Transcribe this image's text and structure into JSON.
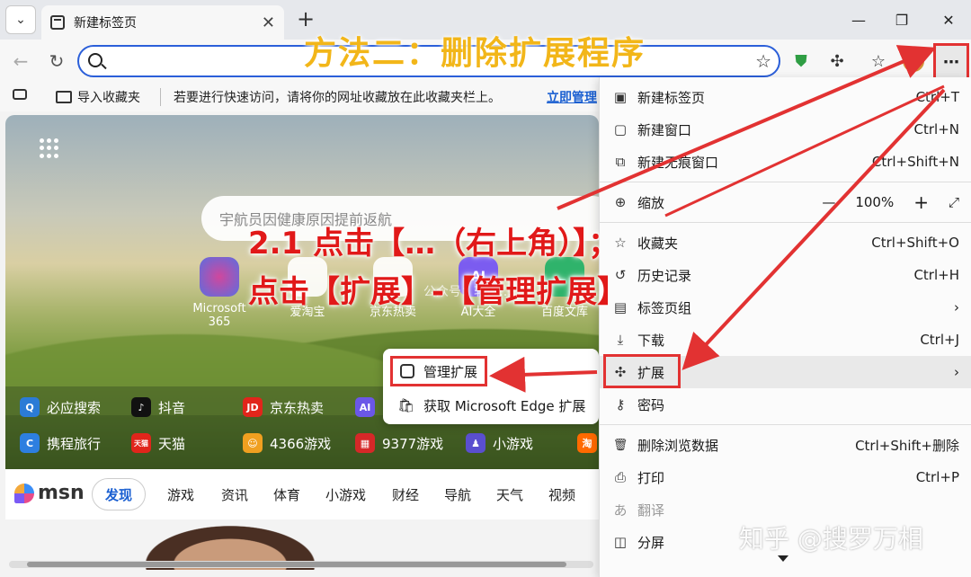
{
  "tab": {
    "title": "新建标签页"
  },
  "overlay_title": "方法二：删除扩展程序",
  "favorites": {
    "import_label": "导入收藏夹",
    "hint": "若要进行快速访问，请将你的网址收藏放在此收藏夹栏上。",
    "manage_link": "立即管理"
  },
  "page": {
    "search_placeholder": "宇航员因健康原因提前返航",
    "tiles": [
      {
        "label": "Microsoft 365",
        "icon": "microsoft-365-icon"
      },
      {
        "label": "爱淘宝",
        "icon": "taobao-icon"
      },
      {
        "label": "京东热卖",
        "icon": "jd-icon"
      },
      {
        "label": "AI大全",
        "icon": "ai-icon",
        "glyph": "AI"
      },
      {
        "label": "百度文库",
        "icon": "baidu-wenku-icon"
      }
    ],
    "watermark": "公众号：软件…",
    "quick_links_row1": [
      {
        "label": "必应搜索",
        "glyph": "Q",
        "color": "#2b7bd6"
      },
      {
        "label": "抖音",
        "glyph": "♪",
        "color": "#111111"
      },
      {
        "label": "京东热卖",
        "glyph": "JD",
        "color": "#e1251b"
      },
      {
        "label": "",
        "glyph": "AI",
        "color": "#6b57e8"
      }
    ],
    "quick_links_row2": [
      {
        "label": "携程旅行",
        "glyph": "C",
        "color": "#2d7fe0"
      },
      {
        "label": "天猫",
        "glyph": "天猫",
        "color": "#e1251b"
      },
      {
        "label": "4366游戏",
        "glyph": "☺",
        "color": "#f0a020"
      },
      {
        "label": "9377游戏",
        "glyph": "▦",
        "color": "#d62828"
      },
      {
        "label": "小游戏",
        "glyph": "♟",
        "color": "#5a4fcf"
      },
      {
        "label": "",
        "glyph": "淘",
        "color": "#ff6a00"
      }
    ],
    "ext_popup": {
      "manage": "管理扩展",
      "get": "获取 Microsoft Edge 扩展"
    }
  },
  "msn": {
    "brand": "msn",
    "discover": "发现",
    "nav": [
      "游戏",
      "资讯",
      "体育",
      "小游戏",
      "财经",
      "导航",
      "天气",
      "视频"
    ]
  },
  "menu": {
    "items": [
      {
        "label": "新建标签页",
        "shortcut": "Ctrl+T",
        "icon": "new-tab-icon",
        "glyph": "▣"
      },
      {
        "label": "新建窗口",
        "shortcut": "Ctrl+N",
        "icon": "new-window-icon",
        "glyph": "▢"
      },
      {
        "label": "新建无痕窗口",
        "shortcut": "Ctrl+Shift+N",
        "icon": "inprivate-icon",
        "glyph": "⧉"
      },
      {
        "label": "缩放",
        "shortcut": "",
        "icon": "zoom-icon",
        "glyph": "⊕"
      },
      {
        "label": "收藏夹",
        "shortcut": "Ctrl+Shift+O",
        "icon": "favorites-icon",
        "glyph": "☆"
      },
      {
        "label": "历史记录",
        "shortcut": "Ctrl+H",
        "icon": "history-icon",
        "glyph": "↺"
      },
      {
        "label": "标签页组",
        "shortcut": "›",
        "icon": "tab-groups-icon",
        "glyph": "▤"
      },
      {
        "label": "下载",
        "shortcut": "Ctrl+J",
        "icon": "download-icon",
        "glyph": "⤓"
      },
      {
        "label": "扩展",
        "shortcut": "›",
        "icon": "extensions-icon",
        "glyph": "✣"
      },
      {
        "label": "密码",
        "shortcut": "",
        "icon": "password-icon",
        "glyph": "⚷"
      },
      {
        "label": "删除浏览数据",
        "shortcut": "Ctrl+Shift+删除",
        "icon": "delete-data-icon",
        "glyph": "🗑"
      },
      {
        "label": "打印",
        "shortcut": "Ctrl+P",
        "icon": "print-icon",
        "glyph": "⎙"
      },
      {
        "label": "翻译",
        "shortcut": "",
        "icon": "translate-icon",
        "glyph": "あ"
      },
      {
        "label": "分屏",
        "shortcut": "",
        "icon": "split-screen-icon",
        "glyph": "◫"
      }
    ],
    "zoom": {
      "minus": "—",
      "value": "100%",
      "plus": "+",
      "expand": "⤢"
    }
  },
  "annotation": {
    "line1": "2.1 点击【…（右上角）】；",
    "line2": "点击【扩展】-【管理扩展】"
  },
  "zhihu_watermark": "知乎 @搜罗万相",
  "colors": {
    "accent_red": "#e23232",
    "title_yellow": "#f2b619",
    "link_blue": "#1a5fd1"
  }
}
